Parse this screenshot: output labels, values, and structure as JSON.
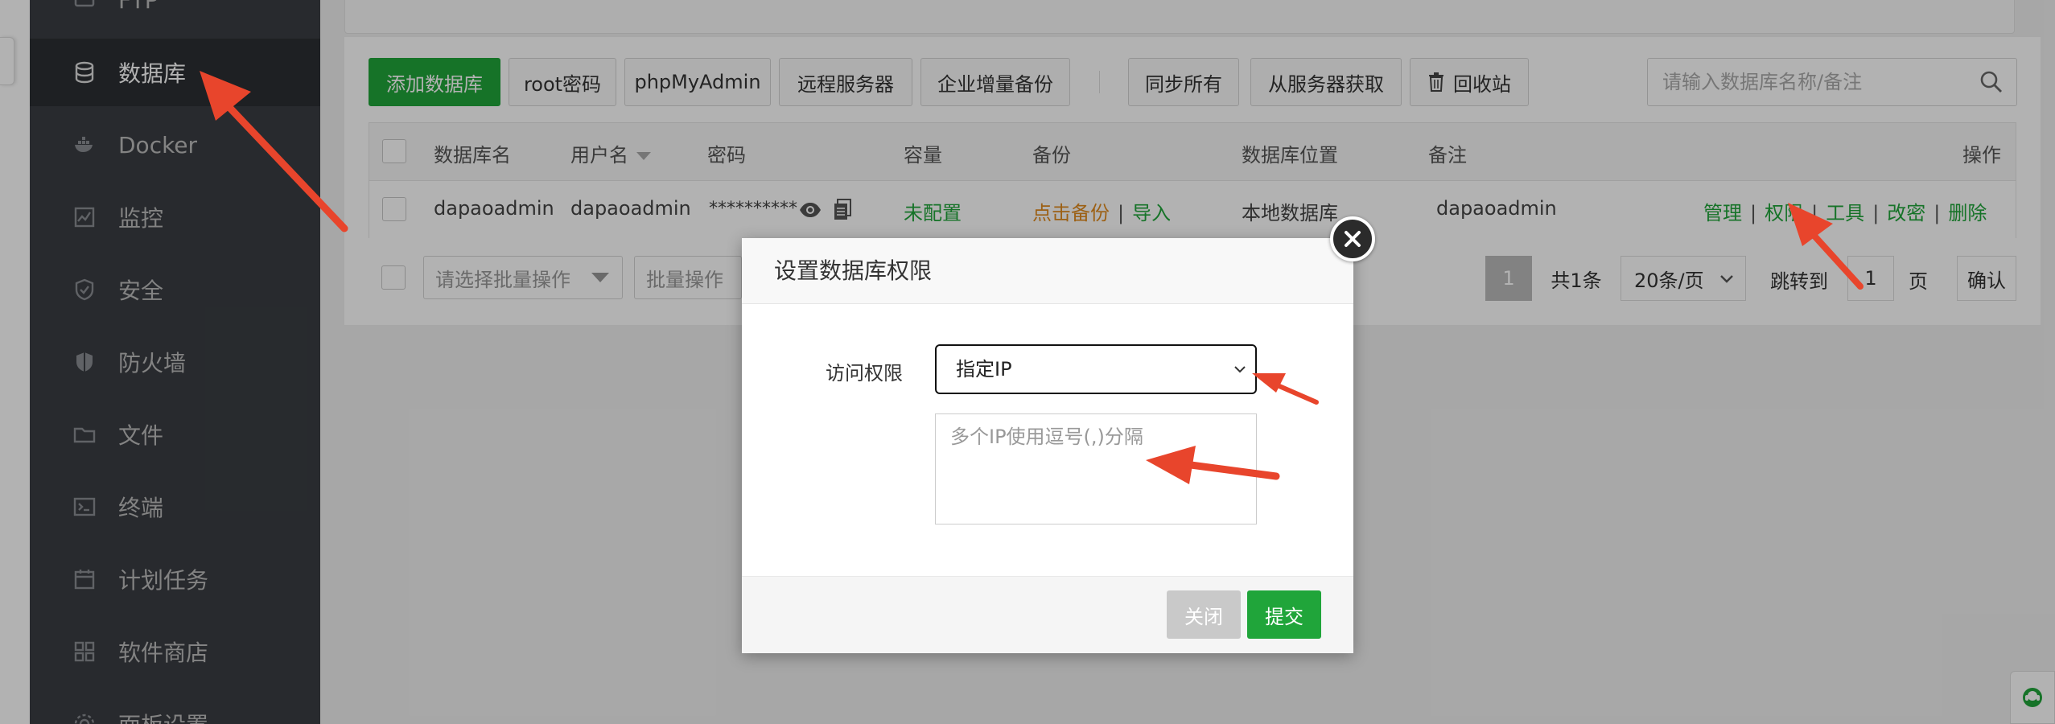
{
  "sidebar": {
    "items": [
      {
        "label": "FTP",
        "icon": "ftp-icon"
      },
      {
        "label": "数据库",
        "icon": "database-icon",
        "active": true
      },
      {
        "label": "Docker",
        "icon": "docker-icon"
      },
      {
        "label": "监控",
        "icon": "monitor-icon"
      },
      {
        "label": "安全",
        "icon": "shield-icon"
      },
      {
        "label": "防火墙",
        "icon": "firewall-icon"
      },
      {
        "label": "文件",
        "icon": "folder-icon"
      },
      {
        "label": "终端",
        "icon": "terminal-icon"
      },
      {
        "label": "计划任务",
        "icon": "calendar-icon"
      },
      {
        "label": "软件商店",
        "icon": "apps-icon"
      },
      {
        "label": "面板设置",
        "icon": "gear-icon"
      }
    ]
  },
  "toolbar": {
    "add_db": "添加数据库",
    "root_password": "root密码",
    "phpmyadmin": "phpMyAdmin",
    "remote_server": "远程服务器",
    "incremental_backup": "企业增量备份",
    "sync_all": "同步所有",
    "fetch_from_server": "从服务器获取",
    "recycle_bin": "回收站"
  },
  "search": {
    "placeholder": "请输入数据库名称/备注"
  },
  "table": {
    "headers": {
      "name": "数据库名",
      "user": "用户名",
      "password": "密码",
      "capacity": "容量",
      "backup": "备份",
      "location": "数据库位置",
      "note": "备注",
      "actions": "操作"
    },
    "row": {
      "name": "dapaoadmin",
      "user": "dapaoadmin",
      "password": "**********",
      "capacity": "未配置",
      "backup_click": "点击备份",
      "backup_import": "导入",
      "location": "本地数据库",
      "note": "dapaoadmin",
      "actions": [
        "管理",
        "权限",
        "工具",
        "改密",
        "删除"
      ]
    }
  },
  "bulk": {
    "select_placeholder": "请选择批量操作",
    "action_label": "批量操作"
  },
  "pager": {
    "current": "1",
    "total": "共1条",
    "per_page": "20条/页",
    "jump_to": "跳转到",
    "jump_value": "1",
    "page_unit": "页",
    "confirm": "确认"
  },
  "modal": {
    "title": "设置数据库权限",
    "access_label": "访问权限",
    "access_value": "指定IP",
    "ip_placeholder": "多个IP使用逗号(,)分隔",
    "close_label": "关闭",
    "submit_label": "提交"
  },
  "colors": {
    "accent": "#20a53a",
    "sidebar_bg": "#3a3d42",
    "arrow": "#e8452c"
  }
}
